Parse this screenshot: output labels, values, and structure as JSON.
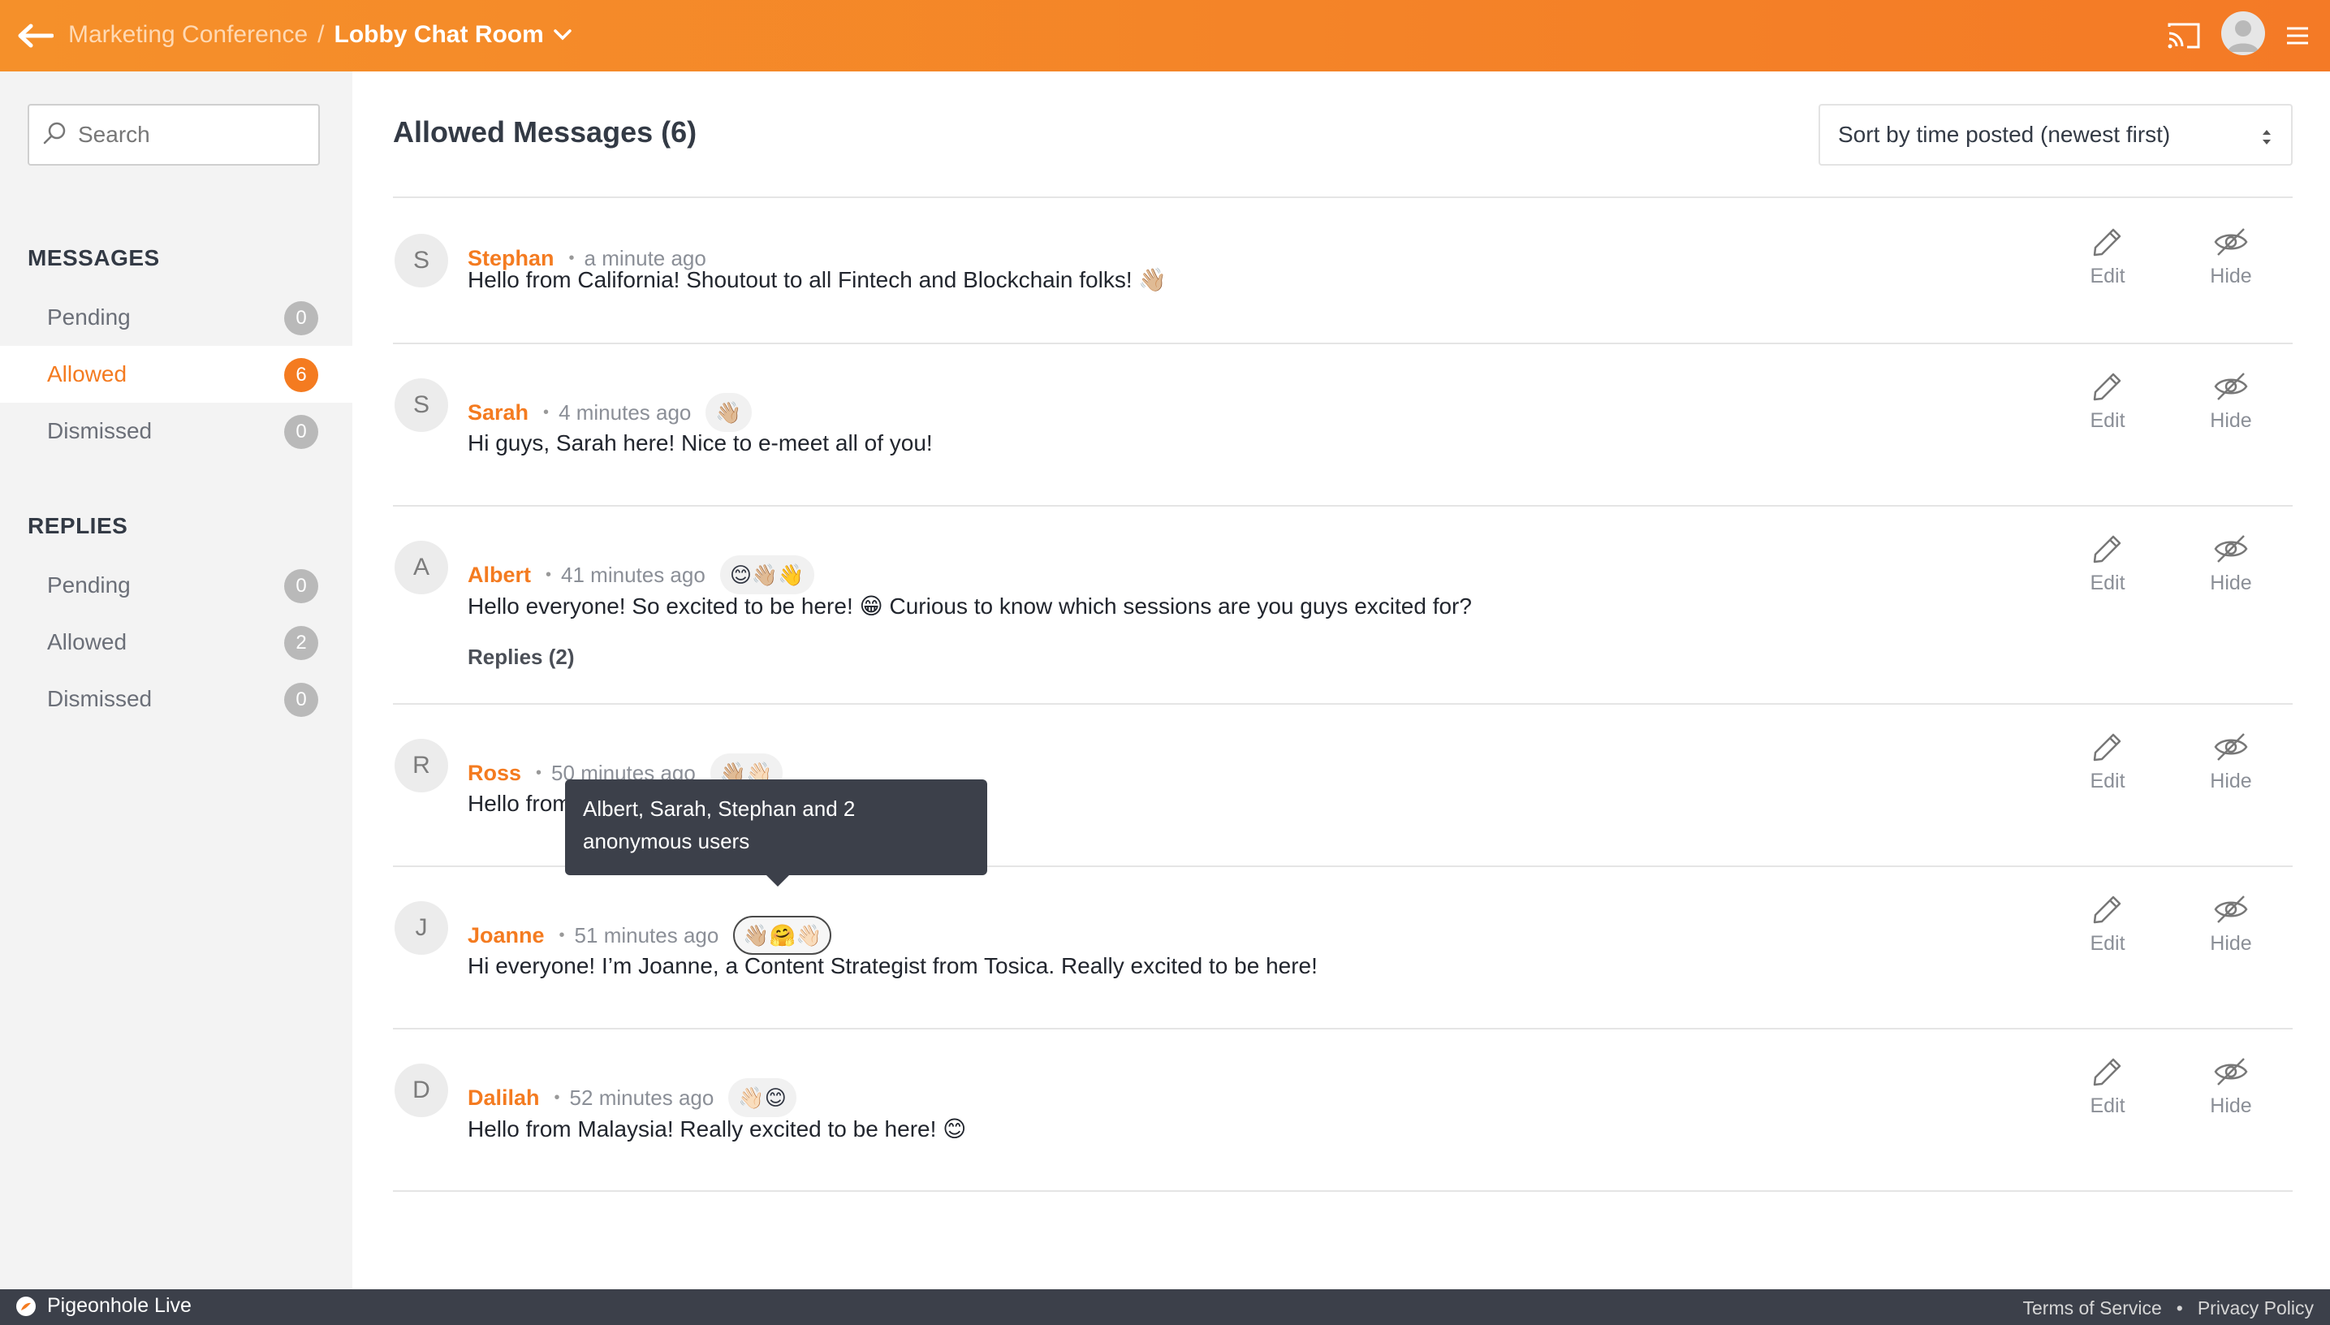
{
  "header": {
    "event_name": "Marketing Conference",
    "separator": "/",
    "room_name": "Lobby Chat Room",
    "accent_color": "#f47b20"
  },
  "sidebar": {
    "search_placeholder": "Search",
    "messages_title": "MESSAGES",
    "messages": [
      {
        "label": "Pending",
        "count": "0"
      },
      {
        "label": "Allowed",
        "count": "6"
      },
      {
        "label": "Dismissed",
        "count": "0"
      }
    ],
    "replies_title": "REPLIES",
    "replies": [
      {
        "label": "Pending",
        "count": "0"
      },
      {
        "label": "Allowed",
        "count": "2"
      },
      {
        "label": "Dismissed",
        "count": "0"
      }
    ]
  },
  "main": {
    "title": "Allowed Messages (6)",
    "sort_label": "Sort by time posted (newest first)",
    "edit_label": "Edit",
    "hide_label": "Hide",
    "messages": [
      {
        "initial": "S",
        "author": "Stephan",
        "time": "a minute ago",
        "reactions": "",
        "text": "Hello from California! Shoutout to all Fintech and Blockchain folks! 👋🏼"
      },
      {
        "initial": "S",
        "author": "Sarah",
        "time": "4 minutes ago",
        "reactions": "👋🏼",
        "text": "Hi guys, Sarah here! Nice to e-meet all of you!"
      },
      {
        "initial": "A",
        "author": "Albert",
        "time": "41 minutes ago",
        "reactions": "😊👋🏼👋",
        "text": "Hello everyone! So excited to be here! 😁 Curious to know which sessions are you guys excited for?",
        "replies": "Replies (2)"
      },
      {
        "initial": "R",
        "author": "Ross",
        "time": "50 minutes ago",
        "reactions": "👋🏼👋🏻",
        "text": "Hello from"
      },
      {
        "initial": "J",
        "author": "Joanne",
        "time": "51 minutes ago",
        "reactions": "👋🏼🤗👋🏻",
        "text": "Hi everyone! I’m Joanne, a Content Strategist from Tosica. Really excited to be here!"
      },
      {
        "initial": "D",
        "author": "Dalilah",
        "time": "52 minutes ago",
        "reactions": "👋🏻😊",
        "text": "Hello from Malaysia! Really excited to be here! 😊"
      }
    ]
  },
  "tooltip": {
    "text": "Albert, Sarah, Stephan and 2 anonymous users"
  },
  "footer": {
    "brand": "Pigeonhole Live",
    "terms": "Terms of Service",
    "separator": "•",
    "privacy": "Privacy Policy"
  }
}
